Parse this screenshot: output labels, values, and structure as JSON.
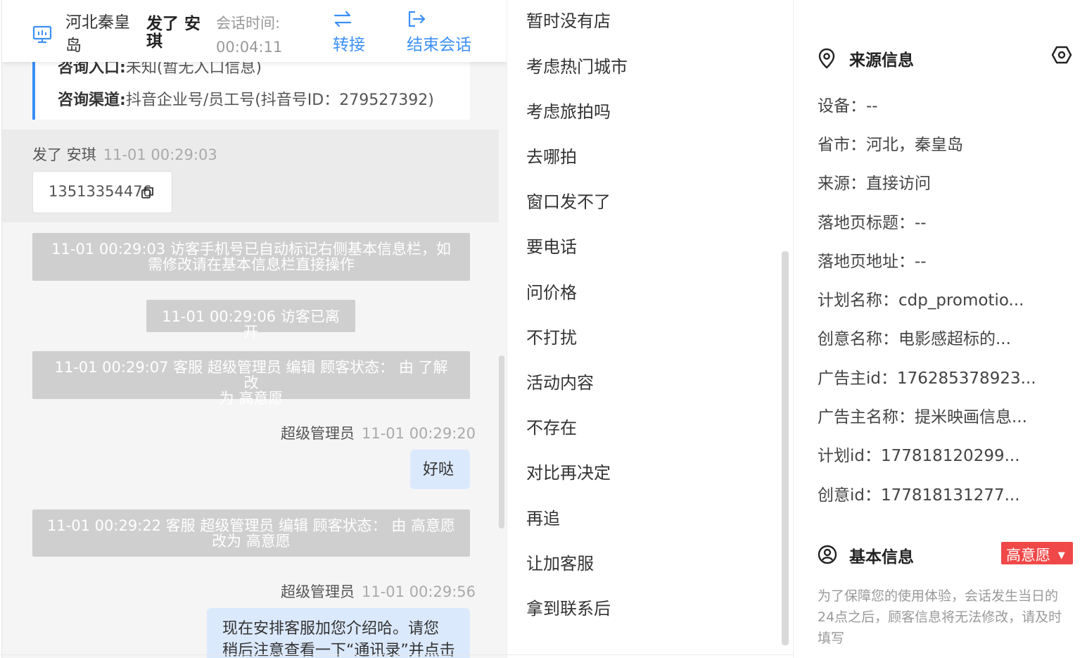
{
  "colors": {
    "accent": "#3b8ff6",
    "tag_red": "#f04848",
    "system_msg_bg": "#cfcfcf",
    "bubble_bg": "#dbe9fd"
  },
  "header": {
    "location": "河北秦皇岛",
    "visitor_name": "发了 安琪",
    "session_time_label": "会话时间:",
    "session_time": "00:04:11",
    "transfer_label": "转接",
    "end_label": "结束会话"
  },
  "source_card": {
    "entry_label": "咨询入口:",
    "entry_value": "未知(暂无入口信息)",
    "channel_label": "咨询渠道:",
    "channel_value": "抖音企业号/员工号(抖音号ID：279527392)"
  },
  "messages": {
    "visitor_name": "发了 安琪",
    "visitor_time": "11-01 00:29:03",
    "visitor_phone": "13513354476",
    "sys1_line1": "11-01 00:29:03 访客手机号已自动标记右侧基本信息栏，如",
    "sys1_line2": "需修改请在基本信息栏直接操作",
    "sys2": "11-01 00:29:06 访客已离开",
    "sys3_line1": "11-01 00:29:07 客服 超级管理员 编辑 顾客状态： 由 了解 改",
    "sys3_line2": "为 高意愿",
    "agent1_name": "超级管理员",
    "agent1_time": "11-01 00:29:20",
    "agent1_text": "好哒",
    "sys4_line1": "11-01 00:29:22 客服 超级管理员 编辑 顾客状态： 由 高意愿",
    "sys4_line2": "改为 高意愿",
    "agent2_name": "超级管理员",
    "agent2_time": "11-01 00:29:56",
    "agent2_line1": "现在安排客服加您介绍哈。请您",
    "agent2_line2": "稍后注意查看一下“通讯录”并点击"
  },
  "quick_replies": [
    "暂时没有店",
    "考虑热门城市",
    "考虑旅拍吗",
    "去哪拍",
    "窗口发不了",
    "要电话",
    "问价格",
    "不打扰",
    "活动内容",
    "不存在",
    "对比再决定",
    "再追",
    "让加客服",
    "拿到联系后"
  ],
  "info": {
    "source_title": "来源信息",
    "device": "设备：--",
    "province": "省市：河北，秦皇岛",
    "source": "来源：直接访问",
    "landing_title": "落地页标题：--",
    "landing_url": "落地页地址：--",
    "plan_name": "计划名称：cdp_promotio...",
    "creative_name": "创意名称：电影感超标的...",
    "advertiser_id": "广告主id：176285378923...",
    "advertiser_name": "广告主名称：提米映画信息...",
    "plan_id": "计划id：177818120299...",
    "creative_id": "创意id：177818131277...",
    "basic_title": "基本信息",
    "status_tag": "高意愿",
    "note": "为了保障您的使用体验，会话发生当日的24点之后，顾客信息将无法修改，请及时填写"
  }
}
